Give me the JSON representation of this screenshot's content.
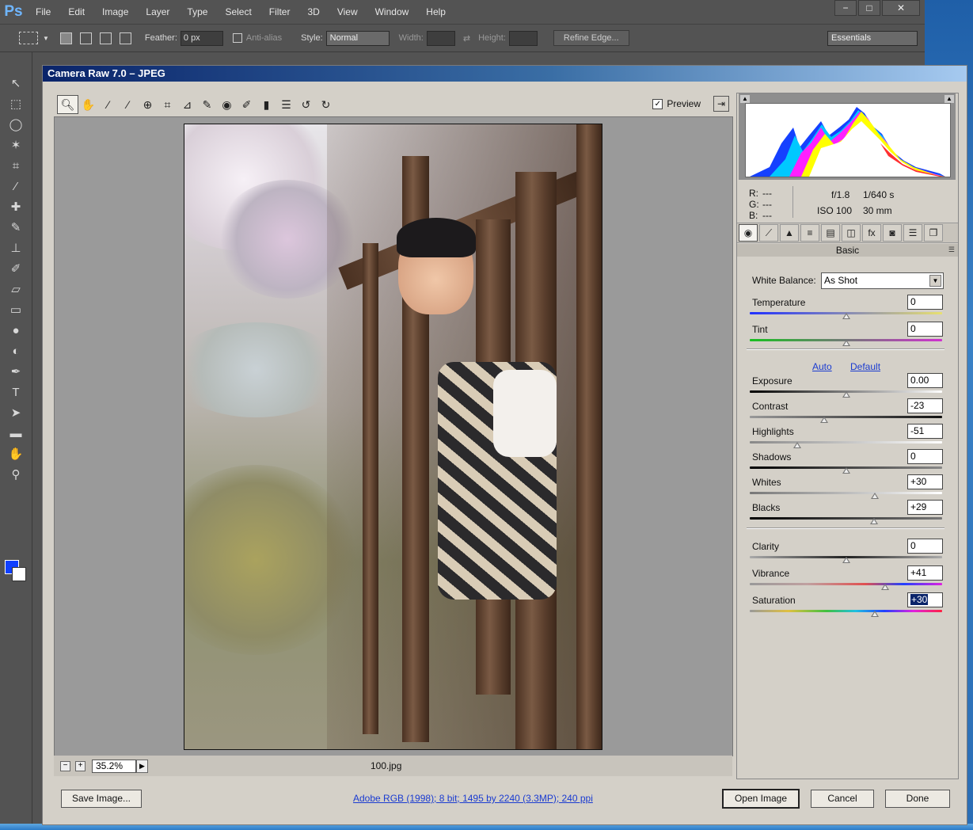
{
  "app": {
    "logo": "Ps",
    "menus": [
      "File",
      "Edit",
      "Image",
      "Layer",
      "Type",
      "Select",
      "Filter",
      "3D",
      "View",
      "Window",
      "Help"
    ],
    "window_buttons": [
      "−",
      "□",
      "✕"
    ]
  },
  "options": {
    "feather_label": "Feather:",
    "feather_value": "0 px",
    "antialias_label": "Anti-alias",
    "style_label": "Style:",
    "style_value": "Normal",
    "width_label": "Width:",
    "height_label": "Height:",
    "refine_label": "Refine Edge...",
    "workspace": "Essentials"
  },
  "dialog": {
    "title": "Camera Raw 7.0  –  JPEG",
    "preview_label": "Preview",
    "preview_checked": true,
    "zoom": "35.2%",
    "filename": "100.jpg",
    "readout": {
      "r": "R:",
      "g": "G:",
      "b": "B:",
      "r_val": "---",
      "g_val": "---",
      "b_val": "---",
      "aperture": "f/1.8",
      "shutter": "1/640 s",
      "iso": "ISO 100",
      "focal": "30 mm"
    },
    "panel_title": "Basic",
    "wb_label": "White Balance:",
    "wb_value": "As Shot",
    "auto_label": "Auto",
    "default_label": "Default",
    "sliders": {
      "temperature": {
        "label": "Temperature",
        "value": "0",
        "pos": 0.5
      },
      "tint": {
        "label": "Tint",
        "value": "0",
        "pos": 0.5
      },
      "exposure": {
        "label": "Exposure",
        "value": "0.00",
        "pos": 0.5
      },
      "contrast": {
        "label": "Contrast",
        "value": "-23",
        "pos": 0.385
      },
      "highlights": {
        "label": "Highlights",
        "value": "-51",
        "pos": 0.245
      },
      "shadows": {
        "label": "Shadows",
        "value": "0",
        "pos": 0.5
      },
      "whites": {
        "label": "Whites",
        "value": "+30",
        "pos": 0.65
      },
      "blacks": {
        "label": "Blacks",
        "value": "+29",
        "pos": 0.645
      },
      "clarity": {
        "label": "Clarity",
        "value": "0",
        "pos": 0.5
      },
      "vibrance": {
        "label": "Vibrance",
        "value": "+41",
        "pos": 0.705
      },
      "saturation": {
        "label": "Saturation",
        "value": "+30",
        "pos": 0.65
      }
    },
    "save_label": "Save Image...",
    "workflow_label": "Adobe RGB (1998); 8 bit; 1495 by 2240 (3.3MP); 240 ppi",
    "open_label": "Open Image",
    "cancel_label": "Cancel",
    "done_label": "Done"
  },
  "colors": {
    "accent": "#1040ff",
    "link": "#1a3bd1",
    "titlebar": "#0a246a"
  }
}
